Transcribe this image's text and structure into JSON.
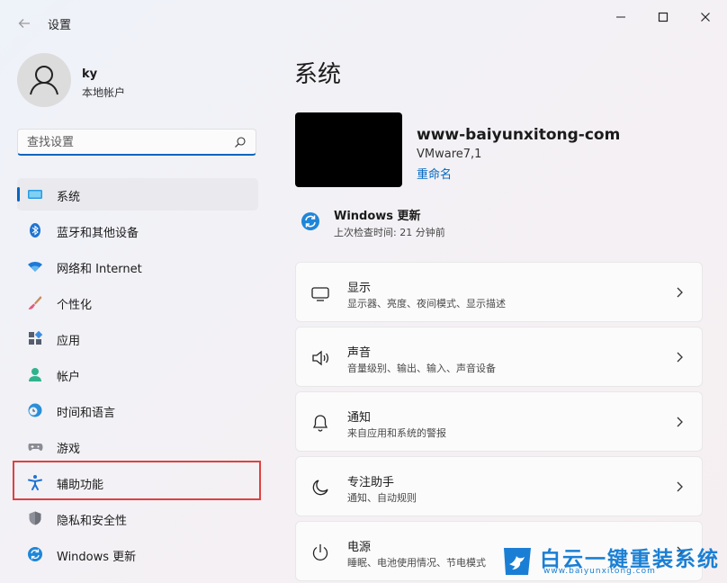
{
  "window": {
    "title": "设置",
    "back_icon": "back-arrow-icon",
    "controls": [
      "minimize-icon",
      "maximize-icon",
      "close-icon"
    ]
  },
  "profile": {
    "name": "ky",
    "account_type": "本地帐户"
  },
  "search": {
    "placeholder": "查找设置"
  },
  "nav": {
    "active": "系统",
    "items": [
      {
        "label": "系统",
        "icon": "system-display-icon"
      },
      {
        "label": "蓝牙和其他设备",
        "icon": "bluetooth-icon"
      },
      {
        "label": "网络和 Internet",
        "icon": "wifi-icon"
      },
      {
        "label": "个性化",
        "icon": "paintbrush-icon"
      },
      {
        "label": "应用",
        "icon": "apps-icon"
      },
      {
        "label": "帐户",
        "icon": "account-icon"
      },
      {
        "label": "时间和语言",
        "icon": "time-language-icon"
      },
      {
        "label": "游戏",
        "icon": "gamepad-icon"
      },
      {
        "label": "辅助功能",
        "icon": "accessibility-icon"
      },
      {
        "label": "隐私和安全性",
        "icon": "shield-icon"
      },
      {
        "label": "Windows 更新",
        "icon": "windows-update-icon"
      }
    ]
  },
  "main": {
    "title": "系统",
    "device": {
      "name": "www-baiyunxitong-com",
      "model": "VMware7,1",
      "rename_label": "重命名"
    },
    "update": {
      "title": "Windows 更新",
      "subtitle": "上次检查时间: 21 分钟前"
    },
    "cards": [
      {
        "title": "显示",
        "subtitle": "显示器、亮度、夜间模式、显示描述",
        "icon": "monitor-icon"
      },
      {
        "title": "声音",
        "subtitle": "音量级别、输出、输入、声音设备",
        "icon": "speaker-icon"
      },
      {
        "title": "通知",
        "subtitle": "来自应用和系统的警报",
        "icon": "bell-icon"
      },
      {
        "title": "专注助手",
        "subtitle": "通知、自动规则",
        "icon": "moon-icon"
      },
      {
        "title": "电源",
        "subtitle": "睡眠、电池使用情况、节电模式",
        "icon": "power-icon"
      }
    ]
  },
  "watermark": {
    "title": "白云一键重装系统",
    "url": "www.baiyunxitong.com"
  },
  "colors": {
    "accent": "#0067c0",
    "highlight_border": "#e0403f",
    "watermark": "#1a7fd4"
  }
}
